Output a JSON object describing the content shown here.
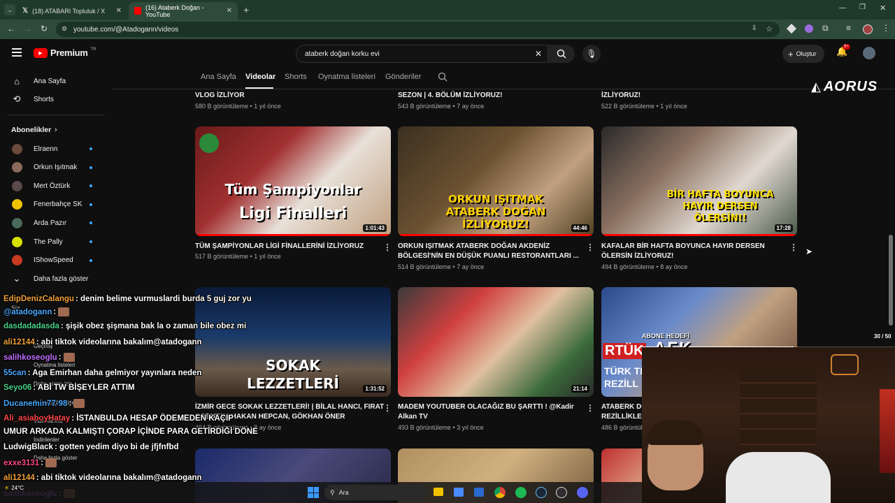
{
  "browser": {
    "tabs": [
      {
        "title": "(18) ATABARI Topluluk / X",
        "active": false
      },
      {
        "title": "(16) Ataberk Doğan - YouTube",
        "active": true
      }
    ],
    "url": "youtube.com/@Atadogann/videos"
  },
  "youtube": {
    "logo": "Premium",
    "logo_region": "TR",
    "search_value": "ataberk doğan korku evi",
    "create_label": "Oluştur",
    "notif_count": "9+",
    "sidebar": {
      "home": "Ana Sayfa",
      "shorts": "Shorts",
      "subs_header": "Abonelikler",
      "subs": [
        {
          "name": "Elraenn",
          "color": "#6a4a3a"
        },
        {
          "name": "Orkun Işıtmak",
          "color": "#8a6a5a"
        },
        {
          "name": "Mert Öztürk",
          "color": "#5a4a4a"
        },
        {
          "name": "Fenerbahçe SK",
          "color": "#f2c200"
        },
        {
          "name": "Arda Pazır",
          "color": "#4a6a5a"
        },
        {
          "name": "The Pally",
          "color": "#d8e000"
        },
        {
          "name": "IShowSpeed",
          "color": "#c83a20"
        }
      ],
      "show_more": "Daha fazla göster"
    },
    "channel_tabs": [
      "Ana Sayfa",
      "Videolar",
      "Shorts",
      "Oynatma listeleri",
      "Gönderiler"
    ],
    "active_tab": "Videolar",
    "top_row": [
      {
        "title": "VLOG İZLİYOR",
        "meta": "580 B görüntüleme • 1 yıl önce"
      },
      {
        "title": "SEZON | 4. BÖLÜM İZLİYORUZ!",
        "meta": "543 B görüntüleme • 7 ay önce"
      },
      {
        "title": "İZLİYORUZ!",
        "meta": "522 B görüntüleme • 1 yıl önce"
      }
    ],
    "videos": [
      {
        "title1": "TÜM ŞAMPİYONLAR LİGİ FİNALLERİNİ İZLİYORUZ",
        "title2": "",
        "meta": "517 B görüntüleme • 1 yıl önce",
        "duration": "1:01:43",
        "thumb_text1": "Tüm Şampiyonlar",
        "thumb_text2": "Ligi Finalleri"
      },
      {
        "title1": "ORKUN IŞITMAK ATABERK DOĞAN AKDENİZ",
        "title2": "BÖLGESİ'NİN EN DÜŞÜK PUANLI RESTORANTLARI ...",
        "meta": "514 B görüntüleme • 7 ay önce",
        "duration": "44:46",
        "thumb_text1": "ORKUN IŞITMAK",
        "thumb_text2": "ATABERK DOĞAN",
        "thumb_text3": "İZLİYORUZ!"
      },
      {
        "title1": "KAFALAR BİR HAFTA BOYUNCA HAYIR DERSEN",
        "title2": "ÖLERSİN İZLİYORUZ!",
        "meta": "494 B görüntüleme • 8 ay önce",
        "duration": "17:28",
        "thumb_text1": "BİR HAFTA BOYUNCA",
        "thumb_text2": "HAYIR DERSEN",
        "thumb_text3": "ÖLERSİN!!"
      },
      {
        "title1": "İZMİR GECE SOKAK LEZZETLERİ! | BİLAL HANCI, FIRAT",
        "title2": "SOBUTAY, HAKAN HEPCAN, GÖKHAN ÖNER",
        "meta": "494 B görüntüleme • 8 ay önce",
        "duration": "1:31:52",
        "thumb_text1": "SOKAK",
        "thumb_text2": "LEZZETLERİ"
      },
      {
        "title1": "MADEM YOUTUBER OLACAĞIZ BU ŞARTTI ! @Kadir",
        "title2": "Alkan TV",
        "meta": "493 B görüntüleme • 3 yıl önce",
        "duration": "21:14"
      },
      {
        "title1": "ATABERK DO",
        "title2": "REZİLLİKLER",
        "meta": "486 B görüntüleme",
        "duration": "",
        "thumb_text1": "RTÜK",
        "thumb_text2": "TÜRK TEL",
        "thumb_text3": "REZİLL"
      }
    ]
  },
  "overlay": {
    "brand": "AORUS",
    "goal_label": "ABONE HEDEFİ",
    "afk": "AFK",
    "goal_count": "30 / 50",
    "chat": [
      {
        "user": "EdipDenizCalangu",
        "color": "#f2a13a",
        "msg": "denim belime vurmuslardi burda 5 guj zor yu"
      },
      {
        "user": "@atadogann",
        "color": "#4aa8ff",
        "msg": ""
      },
      {
        "user": "dasdadadasda",
        "color": "#4ad28a",
        "msg": "şişik obez şişmana bak la o zaman bile obez mi"
      },
      {
        "user": "ali12144",
        "color": "#f2a13a",
        "msg": "abi tiktok videolarına bakalım@atadogann"
      },
      {
        "user": "salihkoseoglu",
        "color": "#c070ff",
        "msg": ""
      },
      {
        "user": "55can",
        "color": "#4aa8ff",
        "msg": "Aga Emirhan daha gelmiyor yayınlara neden"
      },
      {
        "user": "Seyo06",
        "color": "#4ad28a",
        "msg": "ABİ TW BİŞEYLER ATTIM"
      },
      {
        "user": "Ducanemin77-98",
        "color": "#4aa8ff",
        "msg": ""
      },
      {
        "user": "Ali_asiaboyHatay",
        "color": "#ff4a4a",
        "msg": "İSTANBULDA HESAP ÖDEMEDEN KAÇIP"
      },
      {
        "user": "",
        "color": "#fff",
        "msg": "UMUR ARKADA KALMIŞTI ÇORAP İÇİNDE PARA GETİRDİĞİ DÖNE"
      },
      {
        "user": "LudwigBlack",
        "color": "#ffffff",
        "msg": "gotten yedim diyo bi de jfjfnfbd"
      },
      {
        "user": "exxe3131",
        "color": "#ff4a8a",
        "msg": ""
      },
      {
        "user": "ali12144",
        "color": "#f2a13a",
        "msg": "abi tiktok videolarına bakalım@atadogann"
      },
      {
        "user": "salihkoseoglu",
        "color": "#c070ff",
        "msg": ""
      }
    ],
    "hidden_sidebar": [
      "Siz",
      "Geçmiş",
      "Oynatma listeleri",
      "Daha sonra izle",
      "Beğendiğim videolar",
      "Videolarınız",
      "İndirilenler",
      "Daha fazla göster"
    ]
  },
  "taskbar": {
    "search": "Ara",
    "weather": "24°C"
  }
}
